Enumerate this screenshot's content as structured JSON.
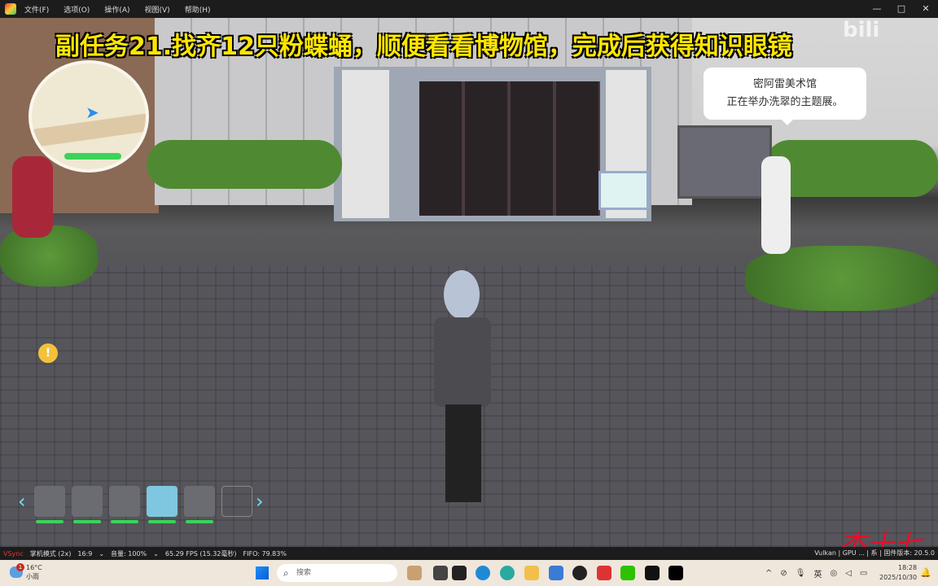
{
  "menubar": {
    "items": [
      "文件(F)",
      "选项(O)",
      "操作(A)",
      "视图(V)",
      "帮助(H)"
    ],
    "window_controls": [
      "—",
      "□",
      "✕"
    ]
  },
  "game": {
    "title_overlay": "副任务21.找齐12只粉蝶蛹，顺便看看博物馆，完成后获得知识眼镜",
    "bubble": {
      "line1": "密阿雷美术馆",
      "line2": "正在举办洗翠的主题展。"
    },
    "alert_icon": "!",
    "party": {
      "slots": 6,
      "active_index": 3,
      "prev": "‹",
      "next": "›"
    },
    "watermark": "bilibili",
    "signature": "杰十七"
  },
  "statusbar": {
    "items": [
      "VSync",
      "掌机模式 (2x)",
      "16:9",
      "⌄",
      "音量: 100%",
      "⌄",
      "65.29 FPS (15.32毫秒)",
      "FIFO: 79.83%"
    ],
    "right": "Vulkan | GPU ... | 系 | 固件版本: 20.5.0"
  },
  "taskbar": {
    "weather_temp": "16°C",
    "weather_desc": "小雨",
    "weather_badge": "1",
    "search_placeholder": "搜索",
    "tray_ime": "英",
    "time": "18:28",
    "date": "2025/10/30"
  },
  "colors": {
    "title": "#ffe600",
    "accent": "#1a5fd0"
  }
}
